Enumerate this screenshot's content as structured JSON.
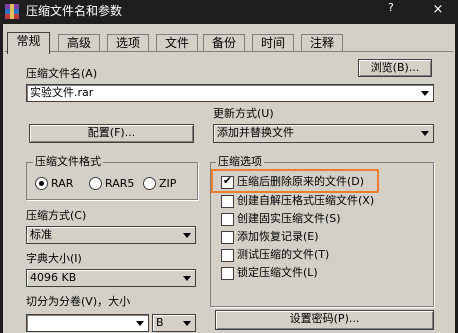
{
  "window": {
    "title": "压缩文件名和参数",
    "help_label": "?",
    "close_label": "×"
  },
  "tabs": [
    {
      "label": "常规"
    },
    {
      "label": "高级"
    },
    {
      "label": "选项"
    },
    {
      "label": "文件"
    },
    {
      "label": "备份"
    },
    {
      "label": "时间"
    },
    {
      "label": "注释"
    }
  ],
  "archive_name": {
    "label": "压缩文件名(A)",
    "value": "实验文件.rar",
    "browse_label": "浏览(B)..."
  },
  "profiles_button": "配置(F)...",
  "update_mode": {
    "label": "更新方式(U)",
    "value": "添加并替换文件"
  },
  "format": {
    "title": "压缩文件格式",
    "options": [
      {
        "label": "RAR",
        "selected": true
      },
      {
        "label": "RAR5",
        "selected": false
      },
      {
        "label": "ZIP",
        "selected": false
      }
    ]
  },
  "compression_method": {
    "label": "压缩方式(C)",
    "value": "标准"
  },
  "dictionary": {
    "label": "字典大小(I)",
    "value": "4096 KB"
  },
  "split": {
    "label": "切分为分卷(V)，大小",
    "value": "",
    "unit": "B"
  },
  "options": {
    "title": "压缩选项",
    "items": [
      {
        "label": "压缩后删除原来的文件(D)",
        "checked": true
      },
      {
        "label": "创建自解压格式压缩文件(X)",
        "checked": false
      },
      {
        "label": "创建固实压缩文件(S)",
        "checked": false
      },
      {
        "label": "添加恢复记录(E)",
        "checked": false
      },
      {
        "label": "测试压缩的文件(T)",
        "checked": false
      },
      {
        "label": "锁定压缩文件(L)",
        "checked": false
      }
    ]
  },
  "password_button": "设置密码(P)...",
  "colors": {
    "highlight": "#ee7e2e",
    "dialog_bg": "#d4d0c8",
    "titlebar_bg": "#1e1e1e"
  },
  "icons": [
    "winrar-icon",
    "help-icon",
    "close-icon",
    "dropdown-arrow-icon",
    "checkmark-icon"
  ]
}
